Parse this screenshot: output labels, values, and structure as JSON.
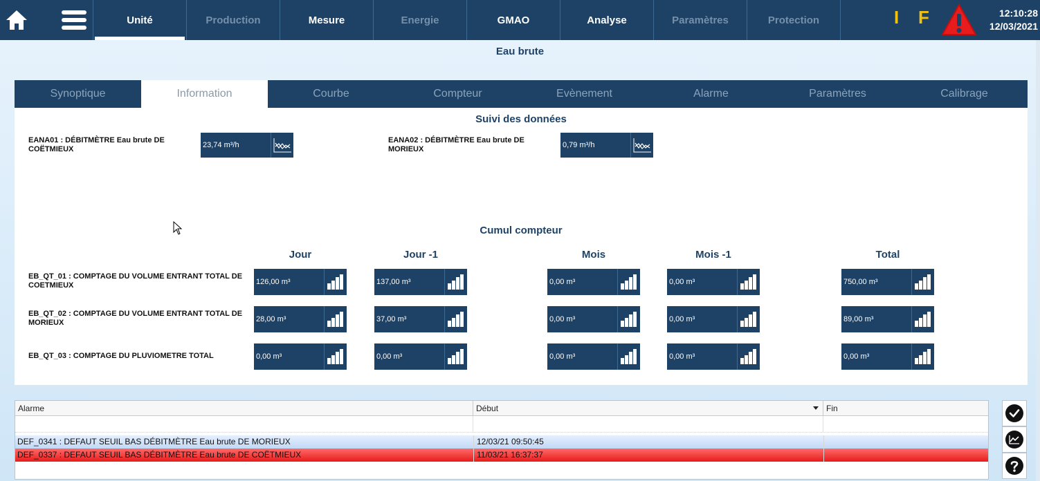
{
  "topbar": {
    "home_icon": "home-icon",
    "menu_icon": "hamburger-menu-icon",
    "tabs": [
      {
        "label": "Unité",
        "state": "active"
      },
      {
        "label": "Production",
        "state": "disabled"
      },
      {
        "label": "Mesure",
        "state": "normal"
      },
      {
        "label": "Energie",
        "state": "disabled"
      },
      {
        "label": "GMAO",
        "state": "normal"
      },
      {
        "label": "Analyse",
        "state": "normal"
      },
      {
        "label": "Paramètres",
        "state": "disabled"
      },
      {
        "label": "Protection",
        "state": "disabled"
      }
    ],
    "flag_i": "I",
    "flag_f": "F",
    "alarm_icon": "alarm-warning-icon",
    "time": "12:10:28",
    "date": "12/03/2021"
  },
  "page": {
    "title": "Eau brute"
  },
  "subtabs": [
    {
      "label": "Synoptique",
      "active": false
    },
    {
      "label": "Information",
      "active": true
    },
    {
      "label": "Courbe",
      "active": false
    },
    {
      "label": "Compteur",
      "active": false
    },
    {
      "label": "Evènement",
      "active": false
    },
    {
      "label": "Alarme",
      "active": false
    },
    {
      "label": "Paramètres",
      "active": false
    },
    {
      "label": "Calibrage",
      "active": false
    }
  ],
  "suivi": {
    "title": "Suivi des données",
    "sensors": [
      {
        "label": "EANA01 : DÉBITMÈTRE Eau brute DE COËTMIEUX",
        "value": "23,74 m³/h",
        "icon": "trend-chart-icon"
      },
      {
        "label": "EANA02 : DÉBITMÈTRE Eau brute DE MORIEUX",
        "value": "0,79 m³/h",
        "icon": "trend-chart-icon"
      }
    ]
  },
  "cumul": {
    "title": "Cumul compteur",
    "columns": [
      "Jour",
      "Jour -1",
      "Mois",
      "Mois -1",
      "Total"
    ],
    "rows": [
      {
        "label": "EB_QT_01 : COMPTAGE DU VOLUME ENTRANT TOTAL DE COETMIEUX",
        "values": [
          "126,00 m³",
          "137,00 m³",
          "0,00 m³",
          "0,00 m³",
          "750,00 m³"
        ]
      },
      {
        "label": "EB_QT_02 : COMPTAGE DU VOLUME ENTRANT TOTAL DE MORIEUX",
        "values": [
          "28,00 m³",
          "37,00 m³",
          "0,00 m³",
          "0,00 m³",
          "89,00 m³"
        ]
      },
      {
        "label": "EB_QT_03 : COMPTAGE DU PLUVIOMETRE TOTAL",
        "values": [
          "0,00 m³",
          "0,00 m³",
          "0,00 m³",
          "0,00 m³",
          "0,00 m³"
        ]
      }
    ],
    "cell_icon": "bar-chart-icon"
  },
  "alarms": {
    "headers": {
      "alarm": "Alarme",
      "start": "Début",
      "end": "Fin"
    },
    "rows": [
      {
        "alarm": "DEF_0341 : DEFAUT SEUIL BAS DÉBITMÈTRE Eau brute DE MORIEUX",
        "start": "12/03/21 09:50:45",
        "end": "",
        "severity": "info"
      },
      {
        "alarm": "DEF_0337 : DEFAUT SEUIL BAS DÉBITMÈTRE Eau brute DE COËTMIEUX",
        "start": "11/03/21 16:37:37",
        "end": "",
        "severity": "critical"
      }
    ]
  },
  "side_buttons": [
    "acknowledge-check-icon",
    "trend-chart-icon",
    "help-question-icon"
  ],
  "colors": {
    "navy": "#1e4266",
    "flag_yellow": "#f4c20d",
    "alarm_red": "#e81c1c",
    "info_blue": "#c2d8f5"
  }
}
